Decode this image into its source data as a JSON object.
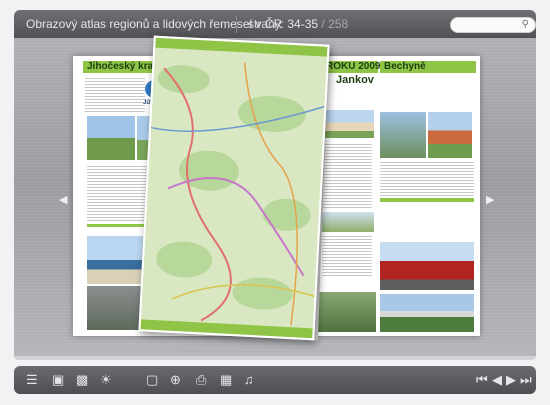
{
  "header": {
    "title": "Obrazový atlas regionů a lidových řemesel v ČR",
    "pages_label": "strany:",
    "current_pages": "34-35",
    "separator": "/",
    "total_pages": "258"
  },
  "search": {
    "placeholder": ""
  },
  "spread": {
    "left_page": {
      "region_heading": "Jihočeský kraj",
      "logo_text": "Jižní Čechy"
    },
    "right_page": {
      "section_heading": "ROKU 2009",
      "town_heading": "Jankov",
      "subheading": "Bechyně"
    }
  },
  "toolbar": {
    "icons": [
      "contents-icon",
      "single-page-icon",
      "thumbnails-icon",
      "share-icon",
      "fullscreen-icon",
      "zoom-icon",
      "print-icon",
      "save-icon",
      "sound-icon"
    ],
    "nav_icons": [
      "first-page-icon",
      "previous-page-icon",
      "next-page-icon",
      "last-page-icon"
    ]
  },
  "colors": {
    "accent_green": "#8fc446",
    "bar_dark": "#4d4e51",
    "stage_grey": "#a6a8ac"
  }
}
